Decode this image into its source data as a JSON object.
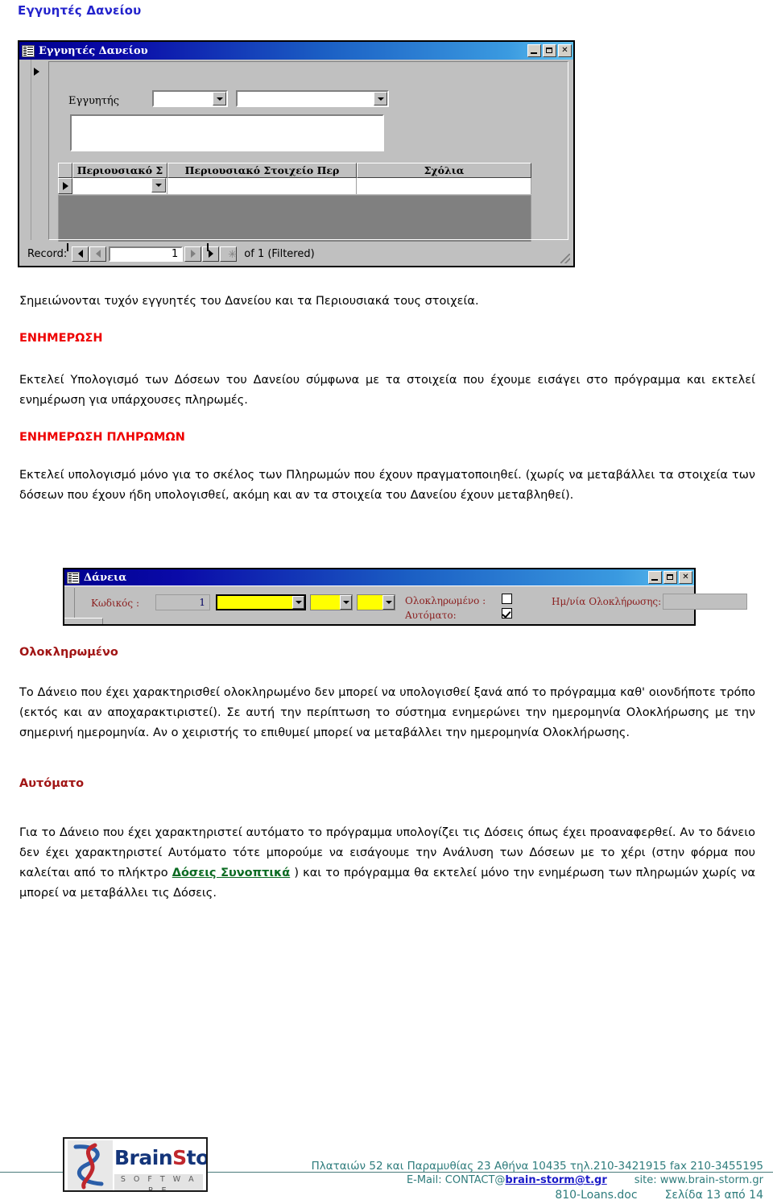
{
  "page": {
    "title": "Εγγυητές Δανείου"
  },
  "window_guarantors": {
    "title": "Εγγυητές Δανείου",
    "icon": "access-form-icon",
    "minimize": "_",
    "maximize": "□",
    "close": "✕",
    "field_label": "Εγγυητής",
    "datasheet": {
      "columns": [
        "Περιουσιακό Σ",
        "Περιουσιακό Στοιχείο Περ",
        "Σχόλια"
      ],
      "rows": [
        [
          "",
          "",
          ""
        ]
      ]
    },
    "navigator": {
      "label": "Record:",
      "first": "first-record-icon",
      "prev": "previous-record-icon",
      "value": "1",
      "next": "next-record-icon",
      "last": "last-record-icon",
      "new": "new-record-icon",
      "status": "of 1 (Filtered)"
    }
  },
  "window_loans": {
    "title": "Δάνεια",
    "icon": "access-form-icon",
    "minimize": "_",
    "maximize": "□",
    "close": "✕",
    "code_label": "Κωδικός :",
    "code_value": "1",
    "combo1_value": "",
    "combo2_value": "",
    "combo3_value": "",
    "completed_label": "Ολοκληρωμένο :",
    "completed_checked": false,
    "auto_label": "Αυτόματο:",
    "auto_checked": true,
    "completion_date_label": "Ημ/νία Ολοκλήρωσης:",
    "completion_date_value": ""
  },
  "body": {
    "intro": "Σημειώνονται τυχόν εγγυητές του Δανείου και τα Περιουσιακά τους στοιχεία.",
    "h_enimerosi": "ΕΝΗΜΕΡΩΣΗ",
    "p_enimerosi": "Εκτελεί Υπολογισμό των Δόσεων του Δανείου σύμφωνα με τα στοιχεία που έχουμε εισάγει στο πρόγραμμα και εκτελεί ενημέρωση για υπάρχουσες πληρωμές.",
    "h_enimerosi_pliromon": "ΕΝΗΜΕΡΩΣΗ ΠΛΗΡΩΜΩΝ",
    "p_enimerosi_pliromon": "Εκτελεί υπολογισμό μόνο για το σκέλος των Πληρωμών που έχουν πραγματοποιηθεί. (χωρίς να μεταβάλλει τα στοιχεία των δόσεων που έχουν ήδη υπολογισθεί, ακόμη και αν τα στοιχεία του Δανείου έχουν μεταβληθεί).",
    "h_olokliromeno": "Ολοκληρωμένο",
    "p_olokliromeno": "Το Δάνειο που έχει χαρακτηρισθεί ολοκληρωμένο δεν μπορεί να υπολογισθεί ξανά από το πρόγραμμα καθ' οιονδήποτε τρόπο (εκτός  και αν αποχαρακτιριστεί). Σε αυτή την περίπτωση το σύστημα ενημερώνει την ημερομηνία Ολοκλήρωσης με την σημερινή ημερομηνία. Αν ο χειριστής το επιθυμεί μπορεί να μεταβάλλει την ημερομηνία Ολοκλήρωσης.",
    "h_automato": "Αυτόματο",
    "p_automato_part1": "Για το Δάνειο που έχει χαρακτηριστεί αυτόματο το πρόγραμμα υπολογίζει τις Δόσεις όπως  έχει προαναφερθεί. Αν το δάνειο δεν έχει χαρακτηριστεί Αυτόματο τότε μπορούμε να εισάγουμε την Ανάλυση των Δόσεων με το χέρι (στην φόρμα που καλείται από το πλήκτρο ",
    "p_automato_link": "Δόσεις Συνοπτικά",
    "p_automato_part2": " ) και το πρόγραμμα θα εκτελεί μόνο την ενημέρωση των πληρωμών χωρίς να μπορεί να μεταβάλλει τις Δόσεις."
  },
  "footer": {
    "logo_brain": "Brain",
    "logo_s": "S",
    "logo_torm": "torm",
    "logo_sub": "S O F T W A R E",
    "address": "Πλαταιών 52 και Παραμυθίας 23 Αθήνα 10435 τηλ.210-3421915 fax 210-3455195",
    "email_prefix": "E-Mail: CONTACT@",
    "email_link": "brain-storm@t.gr",
    "site": "site: www.brain-storm.gr",
    "doc_name": "810-Loans.doc",
    "page_number": "Σελίδα 13 από 14"
  }
}
